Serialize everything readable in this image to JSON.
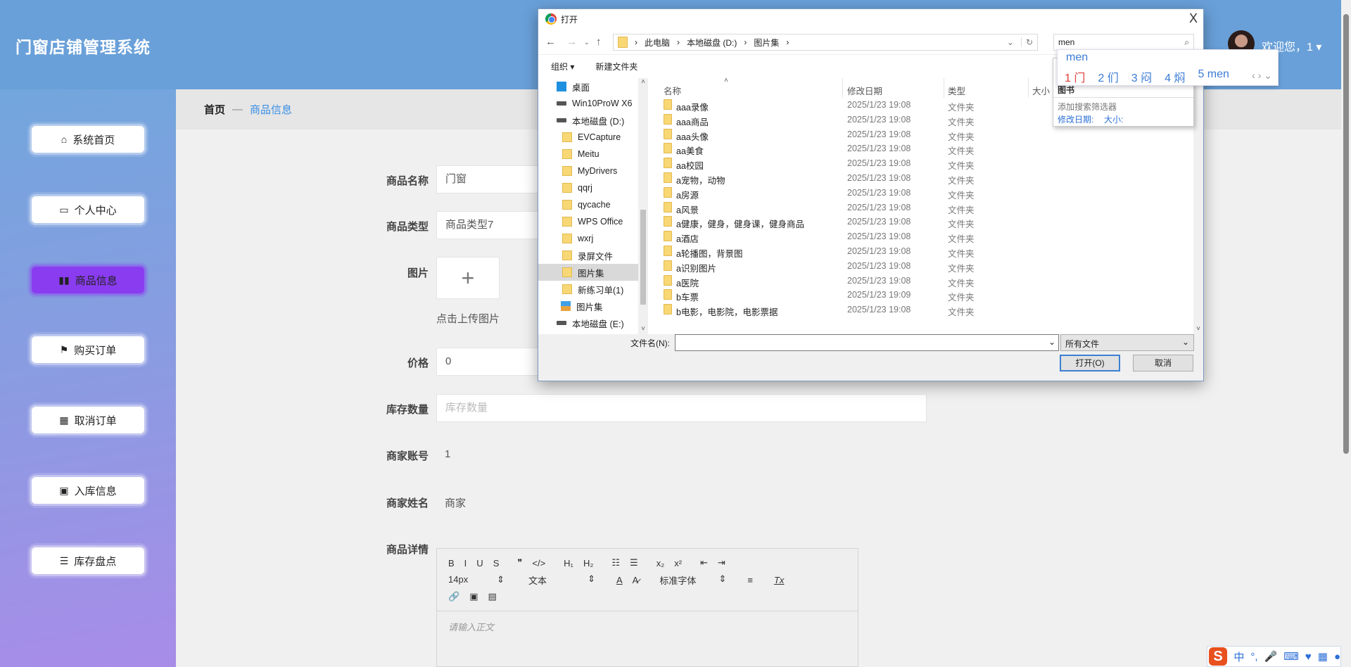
{
  "app": {
    "title": "门窗店铺管理系统",
    "welcome": "欢迎您，1 ▾"
  },
  "sidebar": {
    "items": [
      {
        "label": "系统首页",
        "icon": "⌂"
      },
      {
        "label": "个人中心",
        "icon": "▭"
      },
      {
        "label": "商品信息",
        "icon": "▮▮"
      },
      {
        "label": "购买订单",
        "icon": "⚑"
      },
      {
        "label": "取消订单",
        "icon": "▦"
      },
      {
        "label": "入库信息",
        "icon": "▣"
      },
      {
        "label": "库存盘点",
        "icon": "☰"
      }
    ],
    "active": 2
  },
  "breadcrumb": {
    "home": "首页",
    "sep": "—",
    "current": "商品信息"
  },
  "form": {
    "name_label": "商品名称",
    "name_value": "门窗",
    "type_label": "商品类型",
    "type_value": "商品类型7",
    "image_label": "图片",
    "upload_plus": "+",
    "upload_hint": "点击上传图片",
    "price_label": "价格",
    "price_value": "0",
    "stock_label": "库存数量",
    "stock_placeholder": "库存数量",
    "account_label": "商家账号",
    "account_value": "1",
    "merchant_label": "商家姓名",
    "merchant_value": "商家",
    "detail_label": "商品详情",
    "editor": {
      "row1": [
        "B",
        "I",
        "U",
        "S",
        "❞",
        "</>",
        "H₁",
        "H₂",
        "☷",
        "☰",
        "x₂",
        "x²",
        "⇤",
        "⇥"
      ],
      "font_size": "14px",
      "header": "文本",
      "font_family": "标准字体",
      "row2_icons": [
        "A",
        "A̷",
        "≡",
        "Tx"
      ],
      "row3": [
        "🔗",
        "▣",
        "▤"
      ],
      "placeholder": "请输入正文"
    }
  },
  "dialog": {
    "title": "打开",
    "close": "X",
    "path": [
      "此电脑",
      "本地磁盘 (D:)",
      "图片集"
    ],
    "search_value": "men",
    "organize": "组织 ▾",
    "new_folder": "新建文件夹",
    "nav": [
      {
        "label": "桌面",
        "icon": "desktop"
      },
      {
        "label": "Win10ProW X6",
        "icon": "network-drive"
      },
      {
        "label": "本地磁盘 (D:)",
        "icon": "drive"
      },
      {
        "label": "EVCapture",
        "icon": "folder"
      },
      {
        "label": "Meitu",
        "icon": "folder"
      },
      {
        "label": "MyDrivers",
        "icon": "folder"
      },
      {
        "label": "qqrj",
        "icon": "folder"
      },
      {
        "label": "qycache",
        "icon": "folder"
      },
      {
        "label": "WPS Office",
        "icon": "folder"
      },
      {
        "label": "wxrj",
        "icon": "folder"
      },
      {
        "label": "录屏文件",
        "icon": "folder"
      },
      {
        "label": "图片集",
        "icon": "folder",
        "selected": true
      },
      {
        "label": "新练习单(1)",
        "icon": "folder"
      },
      {
        "label": "图片集",
        "icon": "library"
      },
      {
        "label": "本地磁盘 (E:)",
        "icon": "drive"
      }
    ],
    "columns": {
      "name": "名称",
      "date": "修改日期",
      "type": "类型",
      "size": "大小"
    },
    "files": [
      {
        "name": "aaa录像",
        "date": "2025/1/23 19:08",
        "type": "文件夹"
      },
      {
        "name": "aaa商品",
        "date": "2025/1/23 19:08",
        "type": "文件夹"
      },
      {
        "name": "aaa头像",
        "date": "2025/1/23 19:08",
        "type": "文件夹"
      },
      {
        "name": "aa美食",
        "date": "2025/1/23 19:08",
        "type": "文件夹"
      },
      {
        "name": "aa校园",
        "date": "2025/1/23 19:08",
        "type": "文件夹"
      },
      {
        "name": "a宠物，动物",
        "date": "2025/1/23 19:08",
        "type": "文件夹"
      },
      {
        "name": "a房源",
        "date": "2025/1/23 19:08",
        "type": "文件夹"
      },
      {
        "name": "a风景",
        "date": "2025/1/23 19:08",
        "type": "文件夹"
      },
      {
        "name": "a健康，健身，健身课，健身商品",
        "date": "2025/1/23 19:08",
        "type": "文件夹"
      },
      {
        "name": "a酒店",
        "date": "2025/1/23 19:08",
        "type": "文件夹"
      },
      {
        "name": "a轮播图，背景图",
        "date": "2025/1/23 19:08",
        "type": "文件夹"
      },
      {
        "name": "a识别图片",
        "date": "2025/1/23 19:08",
        "type": "文件夹"
      },
      {
        "name": "a医院",
        "date": "2025/1/23 19:08",
        "type": "文件夹"
      },
      {
        "name": "b车票",
        "date": "2025/1/23 19:09",
        "type": "文件夹"
      },
      {
        "name": "b电影，电影院，电影票据",
        "date": "2025/1/23 19:08",
        "type": "文件夹"
      }
    ],
    "filename_label": "文件名(N):",
    "filename_value": "",
    "filetype": "所有文件",
    "open": "打开(O)",
    "cancel": "取消",
    "search_dropdown": {
      "recent": "图书",
      "add_filter": "添加搜索筛选器",
      "filter_date": "修改日期:",
      "filter_size": "大小:"
    }
  },
  "ime": {
    "composition": "men",
    "candidates": [
      "1 门",
      "2 们",
      "3 闷",
      "4 焖",
      "5 men"
    ],
    "nav": "‹ › ⌄",
    "bar": [
      "中",
      "°,",
      "🎤",
      "⌨",
      "♥",
      "▦",
      "●"
    ]
  }
}
